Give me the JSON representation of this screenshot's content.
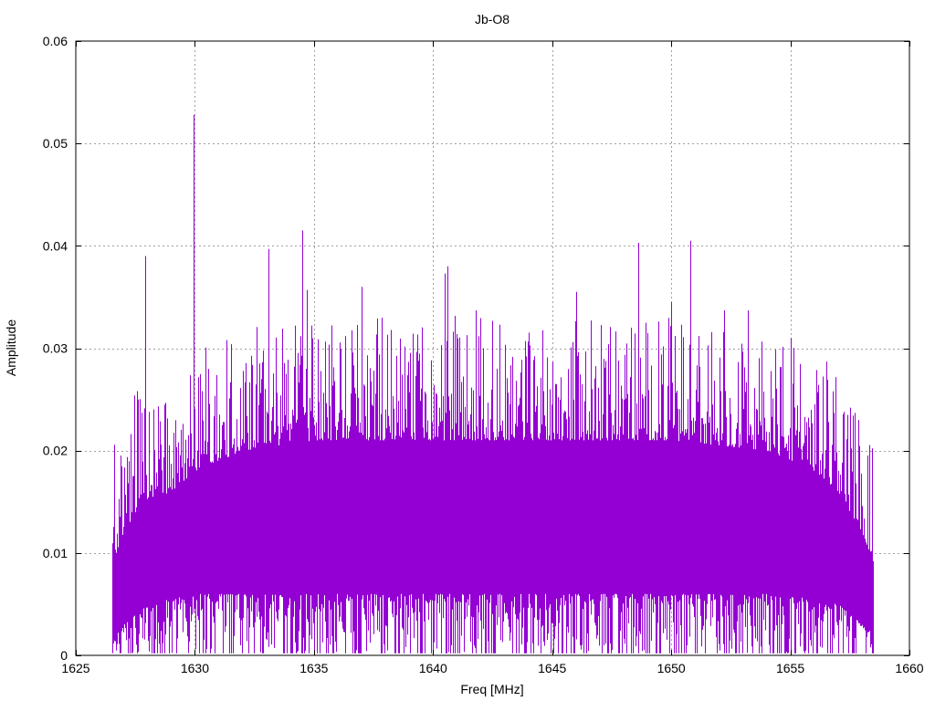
{
  "chart_data": {
    "type": "line",
    "title": "Jb-O8",
    "xlabel": "Freq [MHz]",
    "ylabel": "Amplitude",
    "xlim": [
      1625,
      1660
    ],
    "ylim": [
      0,
      0.06
    ],
    "xticks": [
      1625,
      1630,
      1635,
      1640,
      1645,
      1650,
      1655,
      1660
    ],
    "xtick_labels": [
      "1625",
      "1630",
      "1635",
      "1640",
      "1645",
      "1650",
      "1655",
      "1660"
    ],
    "yticks": [
      0,
      0.01,
      0.02,
      0.03,
      0.04,
      0.05,
      0.06
    ],
    "ytick_labels": [
      "0",
      "0.01",
      "0.02",
      "0.03",
      "0.04",
      "0.05",
      "0.06"
    ],
    "grid": true,
    "legend": "none",
    "color": "#9400d3",
    "series": [
      {
        "signal_range": [
          1626.5,
          1658.5
        ],
        "band_envelope": {
          "freq": [
            1626.5,
            1626.7,
            1627.0,
            1627.5,
            1628.0,
            1629.0,
            1630.0,
            1632.0,
            1635.0,
            1640.0,
            1645.0,
            1650.0,
            1654.0,
            1656.0,
            1657.0,
            1657.5,
            1658.0,
            1658.5
          ],
          "low": [
            0.001,
            0.002,
            0.003,
            0.004,
            0.005,
            0.0055,
            0.006,
            0.006,
            0.006,
            0.006,
            0.006,
            0.006,
            0.006,
            0.0055,
            0.005,
            0.004,
            0.003,
            0.002
          ],
          "high": [
            0.008,
            0.01,
            0.012,
            0.014,
            0.015,
            0.016,
            0.018,
            0.02,
            0.021,
            0.021,
            0.021,
            0.021,
            0.02,
            0.018,
            0.016,
            0.014,
            0.012,
            0.009
          ]
        },
        "peaks": [
          {
            "x": 1627.9,
            "y": 0.039
          },
          {
            "x": 1629.95,
            "y": 0.0528
          },
          {
            "x": 1633.1,
            "y": 0.0397
          },
          {
            "x": 1634.5,
            "y": 0.0415
          },
          {
            "x": 1634.7,
            "y": 0.0357
          },
          {
            "x": 1637.0,
            "y": 0.036
          },
          {
            "x": 1640.5,
            "y": 0.0373
          },
          {
            "x": 1640.6,
            "y": 0.038
          },
          {
            "x": 1641.8,
            "y": 0.0337
          },
          {
            "x": 1646.0,
            "y": 0.0355
          },
          {
            "x": 1648.6,
            "y": 0.0403
          },
          {
            "x": 1650.0,
            "y": 0.0345
          },
          {
            "x": 1650.8,
            "y": 0.0405
          },
          {
            "x": 1652.2,
            "y": 0.0337
          },
          {
            "x": 1653.2,
            "y": 0.0337
          },
          {
            "x": 1655.0,
            "y": 0.031
          }
        ]
      }
    ]
  }
}
